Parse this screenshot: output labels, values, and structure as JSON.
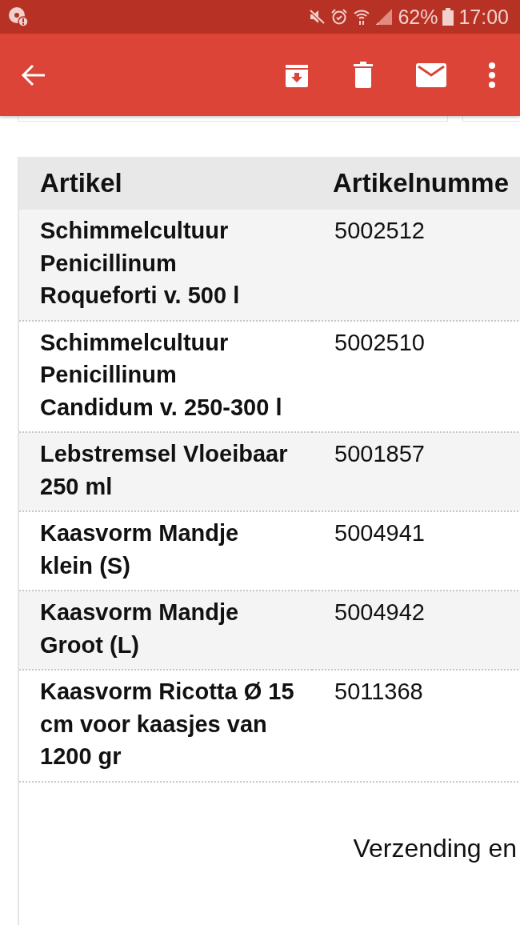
{
  "status_bar": {
    "battery_text": "62%",
    "time": "17:00"
  },
  "table": {
    "columns": [
      "Artikel",
      "Artikelnumme"
    ],
    "rows": [
      {
        "artikel": "Schimmelcultuur Penicillinum Roqueforti v. 500 l",
        "nummer": "5002512"
      },
      {
        "artikel": "Schimmelcultuur Penicillinum Candidum v. 250-300 l",
        "nummer": "5002510"
      },
      {
        "artikel": "Lebstremsel Vloeibaar 250 ml",
        "nummer": "5001857"
      },
      {
        "artikel": "Kaasvorm Mandje klein (S)",
        "nummer": "5004941"
      },
      {
        "artikel": "Kaasvorm Mandje Groot (L)",
        "nummer": "5004942"
      },
      {
        "artikel": "Kaasvorm Ricotta Ø 15 cm voor kaasjes van 1200 gr",
        "nummer": "5011368"
      }
    ]
  },
  "footer_text": "Verzending en"
}
